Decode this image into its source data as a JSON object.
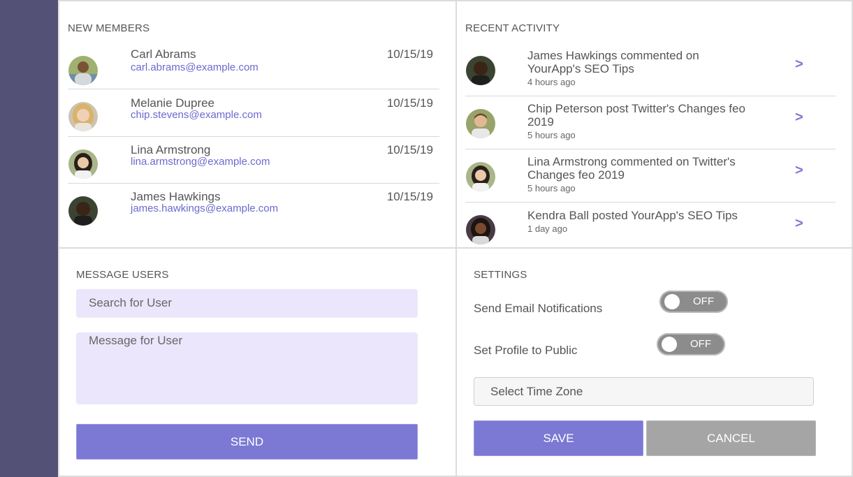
{
  "members": {
    "title": "NEW MEMBERS",
    "items": [
      {
        "name": "Carl Abrams",
        "email": "carl.abrams@example.com",
        "date": "10/15/19"
      },
      {
        "name": "Melanie Dupree",
        "email": "chip.stevens@example.com",
        "date": "10/15/19"
      },
      {
        "name": "Lina Armstrong",
        "email": "lina.armstrong@example.com",
        "date": "10/15/19"
      },
      {
        "name": "James Hawkings",
        "email": "james.hawkings@example.com",
        "date": "10/15/19"
      }
    ]
  },
  "activity": {
    "title": "RECENT ACTIVITY",
    "items": [
      {
        "line1": "James Hawkings commented on",
        "line2": "YourApp's SEO Tips",
        "time": "4 hours ago",
        "arrow": ">"
      },
      {
        "line1": "Chip Peterson post Twitter's Changes feo",
        "line2": "2019",
        "time": "5 hours ago",
        "arrow": ">"
      },
      {
        "line1": "Lina Armstrong commented on Twitter's",
        "line2": "Changes feo 2019",
        "time": "5 hours ago",
        "arrow": ">"
      },
      {
        "line1": "Kendra Ball posted YourApp's SEO Tips",
        "line2": "",
        "time": "1 day ago",
        "arrow": ">"
      }
    ]
  },
  "message": {
    "title": "MESSAGE USERS",
    "search_placeholder": "Search for User",
    "message_placeholder": "Message for User",
    "send_label": "SEND"
  },
  "settings": {
    "title": "SETTINGS",
    "email_label": "Send Email Notifications",
    "email_toggle": "OFF",
    "public_label": "Set Profile to Public",
    "public_toggle": "OFF",
    "timezone_placeholder": "Select Time Zone",
    "save_label": "SAVE",
    "cancel_label": "CANCEL"
  },
  "colors": {
    "sidebar": "#535175",
    "accent": "#7b79d3",
    "input_bg": "#ebe6fb",
    "toggle_off": "#8c8c8c",
    "cancel": "#a5a5a5"
  }
}
